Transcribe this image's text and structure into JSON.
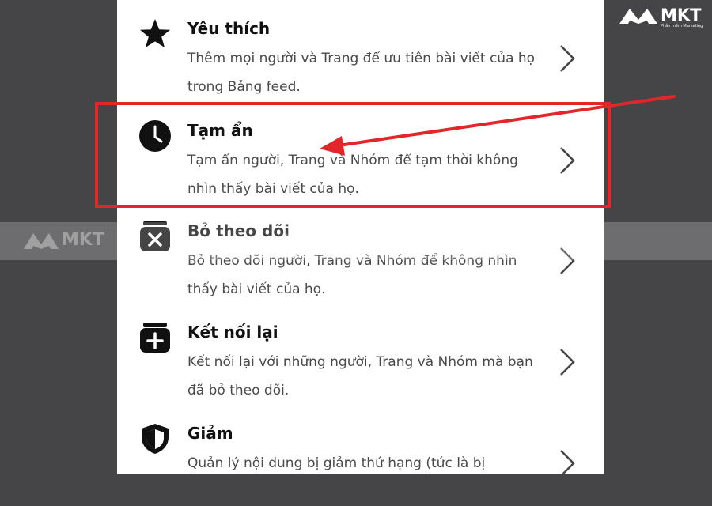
{
  "menu": {
    "items": [
      {
        "title": "Yêu thích",
        "desc": "Thêm mọi người và Trang để ưu tiên bài viết của họ trong Bảng feed.",
        "icon": "star-icon"
      },
      {
        "title": "Tạm ẩn",
        "desc": "Tạm ẩn người, Trang và Nhóm để tạm thời không nhìn thấy bài viết của họ.",
        "icon": "clock-icon"
      },
      {
        "title": "Bỏ theo dõi",
        "desc": "Bỏ theo dõi người, Trang và Nhóm để không nhìn thấy bài viết của họ.",
        "icon": "box-x-icon"
      },
      {
        "title": "Kết nối lại",
        "desc": "Kết nối lại với những người, Trang và Nhóm mà bạn đã bỏ theo dõi.",
        "icon": "box-plus-icon"
      },
      {
        "title": "Giảm",
        "desc": "Quản lý nội dung bị giảm thứ hạng (tức là bị",
        "icon": "shield-icon"
      }
    ]
  },
  "watermark": {
    "brand": "MKT",
    "tagline": "Phần mềm Marketing"
  },
  "colors": {
    "highlight": "#e3262a",
    "background": "#454547",
    "panel": "#ffffff"
  }
}
